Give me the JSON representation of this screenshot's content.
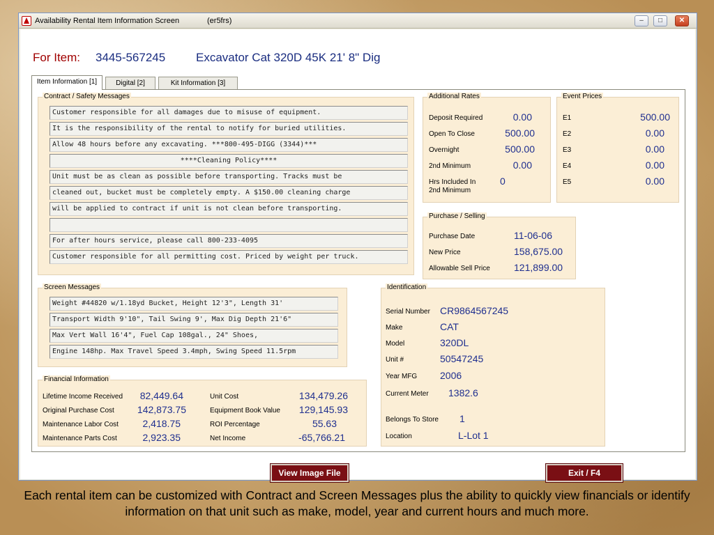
{
  "window": {
    "title": "Availability Rental Item Information Screen",
    "code": "(er5frs)"
  },
  "header": {
    "item_label": "For Item:",
    "item_number": "3445-567245",
    "item_description": "Excavator Cat 320D 45K 21' 8\" Dig"
  },
  "tabs": [
    {
      "label": "Item Information [1]",
      "active": true
    },
    {
      "label": "Digital [2]",
      "active": false
    },
    {
      "label": "Kit Information [3]",
      "active": false
    }
  ],
  "contract": {
    "title": "Contract / Safety Messages",
    "lines": [
      "Customer responsible for all damages due to misuse of equipment.",
      "It is the responsibility of the rental to notify for buried utilities.",
      "Allow 48 hours before any excavating. ***800-495-DIGG (3344)***",
      "****Cleaning Policy****",
      "Unit must be as clean as possible before transporting. Tracks must be",
      "cleaned out, bucket must be completely empty. A $150.00 cleaning charge",
      "will be applied to contract if unit is not clean before transporting.",
      "",
      "For after hours service, please call 800-233-4095",
      "Customer responsible for all permitting cost. Priced by weight per truck."
    ]
  },
  "screen_messages": {
    "title": "Screen Messages",
    "lines": [
      "Weight #44820 w/1.18yd Bucket, Height 12'3\", Length 31'",
      "Transport Width 9'10\", Tail Swing 9', Max Dig Depth 21'6\"",
      "Max Vert Wall 16'4\", Fuel Cap 108gal., 24\" Shoes,",
      "Engine 148hp. Max Travel Speed 3.4mph, Swing Speed 11.5rpm"
    ]
  },
  "financial": {
    "title": "Financial Information",
    "left": [
      {
        "label": "Lifetime Income Received",
        "value": "82,449.64"
      },
      {
        "label": "Original Purchase Cost",
        "value": "142,873.75"
      },
      {
        "label": "Maintenance Labor Cost",
        "value": "2,418.75"
      },
      {
        "label": "Maintenance Parts Cost",
        "value": "2,923.35"
      }
    ],
    "right": [
      {
        "label": "Unit Cost",
        "value": "134,479.26"
      },
      {
        "label": "Equipment Book Value",
        "value": "129,145.93"
      },
      {
        "label": "ROI Percentage",
        "value": "55.63"
      },
      {
        "label": "Net Income",
        "value": "-65,766.21"
      }
    ]
  },
  "additional_rates": {
    "title": "Additional Rates",
    "rows": [
      {
        "label": "Deposit Required",
        "value": "0.00"
      },
      {
        "label": "Open To Close",
        "value": "500.00"
      },
      {
        "label": "Overnight",
        "value": "500.00"
      },
      {
        "label": "2nd Minimum",
        "value": "0.00"
      },
      {
        "label": "Hrs Included In",
        "label2": "2nd Minimum",
        "value": "0"
      }
    ]
  },
  "event_prices": {
    "title": "Event Prices",
    "rows": [
      {
        "label": "E1",
        "value": "500.00"
      },
      {
        "label": "E2",
        "value": "0.00"
      },
      {
        "label": "E3",
        "value": "0.00"
      },
      {
        "label": "E4",
        "value": "0.00"
      },
      {
        "label": "E5",
        "value": "0.00"
      }
    ]
  },
  "purchase": {
    "title": "Purchase / Selling",
    "rows": [
      {
        "label": "Purchase Date",
        "value": "11-06-06"
      },
      {
        "label": "New Price",
        "value": "158,675.00"
      },
      {
        "label": "Allowable Sell Price",
        "value": "121,899.00"
      }
    ]
  },
  "identification": {
    "title": "Identification",
    "rows": [
      {
        "label": "Serial Number",
        "value": "CR9864567245"
      },
      {
        "label": "Make",
        "value": "CAT"
      },
      {
        "label": "Model",
        "value": "320DL"
      },
      {
        "label": "Unit #",
        "value": "50547245"
      },
      {
        "label": "Year MFG",
        "value": "2006"
      },
      {
        "label": "Current Meter",
        "value": "1382.6"
      },
      {
        "label": "Belongs To Store",
        "value": "1"
      },
      {
        "label": "Location",
        "value": "L-Lot 1"
      }
    ]
  },
  "buttons": {
    "view_image": "View Image File",
    "exit": "Exit / F4"
  },
  "caption": "Each rental item can be customized with Contract and Screen Messages plus the ability to quickly view financials or identify information on that unit such as make, model, year and current hours and much more.",
  "colors": {
    "value_blue": "#1f2f8f",
    "heading_red": "#a00000",
    "button_maroon": "#7a0f14",
    "group_bg": "#fbeed6"
  }
}
